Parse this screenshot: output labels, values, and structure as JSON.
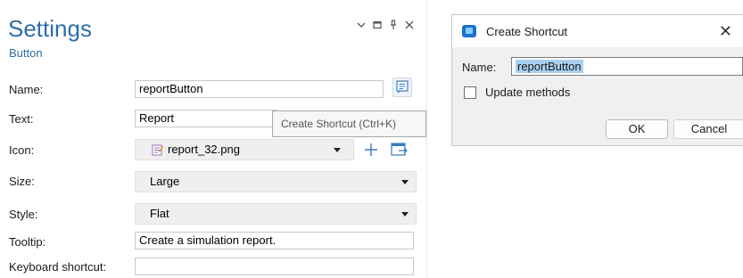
{
  "settings": {
    "title": "Settings",
    "subtitle": "Button",
    "window_controls": [
      "chevron-down",
      "maximize",
      "pin",
      "close"
    ],
    "fields": {
      "name": {
        "label": "Name:",
        "value": "reportButton"
      },
      "text": {
        "label": "Text:",
        "value": "Report"
      },
      "icon": {
        "label": "Icon:",
        "value": "report_32.png"
      },
      "size": {
        "label": "Size:",
        "value": "Large"
      },
      "style": {
        "label": "Style:",
        "value": "Flat"
      },
      "tooltip": {
        "label": "Tooltip:",
        "value": "Create a simulation report."
      },
      "keyboard_shortcut": {
        "label": "Keyboard shortcut:",
        "value": ""
      }
    },
    "hover_tooltip": "Create Shortcut (Ctrl+K)"
  },
  "dialog": {
    "title": "Create Shortcut",
    "close_glyph": "✕",
    "name_label": "Name:",
    "name_value": "reportButton",
    "checkbox_label": "Update methods",
    "checkbox_checked": false,
    "ok_label": "OK",
    "cancel_label": "Cancel"
  },
  "colors": {
    "accent": "#2e6ea7",
    "selection": "#a9cff0"
  }
}
